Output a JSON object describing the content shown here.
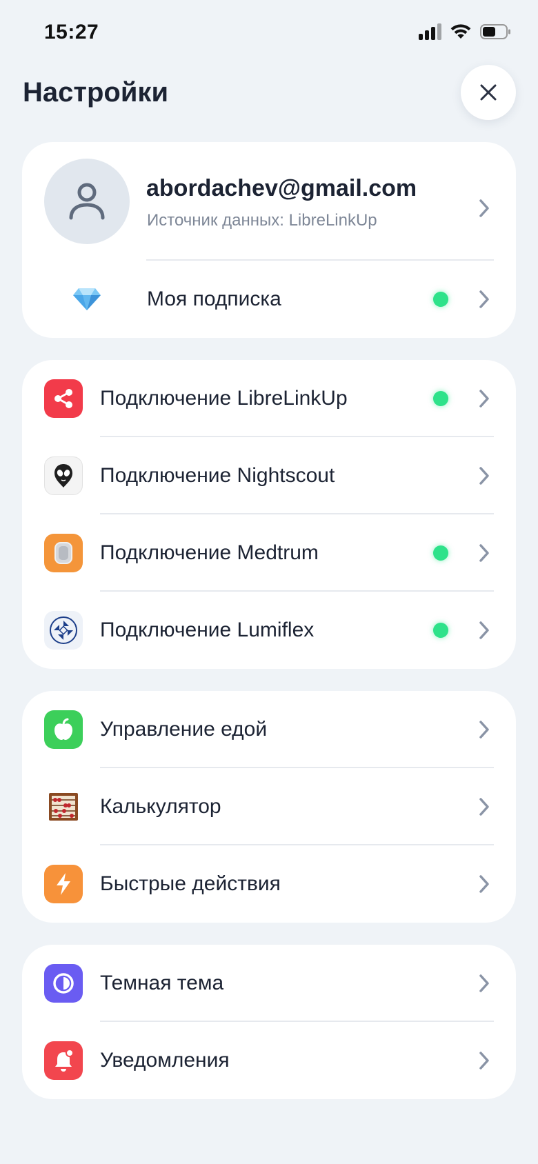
{
  "status_bar": {
    "time": "15:27"
  },
  "header": {
    "title": "Настройки"
  },
  "profile": {
    "email": "abordachev@gmail.com",
    "source": "Источник данных: LibreLinkUp",
    "subscription_label": "Моя подписка",
    "subscription_active": true
  },
  "connections": {
    "items": [
      {
        "label": "Подключение LibreLinkUp",
        "icon": "share-icon",
        "active": true
      },
      {
        "label": "Подключение Nightscout",
        "icon": "alien-icon",
        "active": false
      },
      {
        "label": "Подключение Medtrum",
        "icon": "sensor-icon",
        "active": true
      },
      {
        "label": "Подключение Lumiflex",
        "icon": "lumiflex-icon",
        "active": true
      }
    ]
  },
  "tools": {
    "items": [
      {
        "label": "Управление едой",
        "icon": "apple-icon"
      },
      {
        "label": "Калькулятор",
        "icon": "abacus-icon"
      },
      {
        "label": "Быстрые действия",
        "icon": "lightning-icon"
      }
    ]
  },
  "preferences": {
    "items": [
      {
        "label": "Темная тема",
        "icon": "theme-icon"
      },
      {
        "label": "Уведомления",
        "icon": "bell-icon"
      }
    ]
  },
  "colors": {
    "background": "#eff3f7",
    "card": "#ffffff",
    "active_dot": "#2ee28a",
    "chevron": "#8a94a6"
  }
}
